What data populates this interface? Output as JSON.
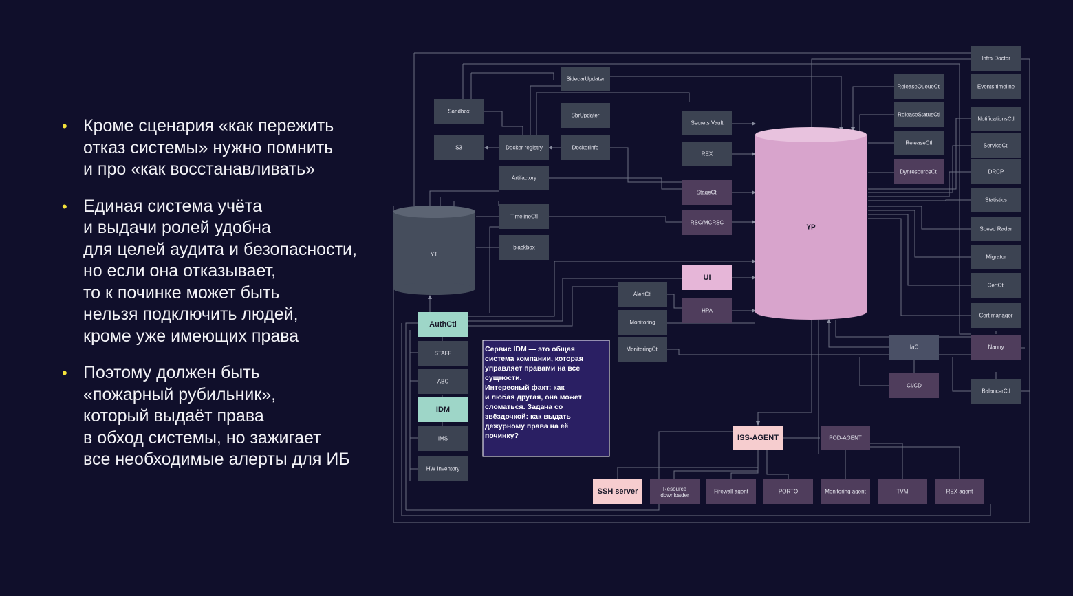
{
  "bullets": [
    "Кроме сценария «как пережить\nотказ системы» нужно помнить\nи про «как восстанавливать»",
    "Единая система учёта\nи выдачи ролей удобна\nдля целей аудита и безопасности,\nно если она отказывает,\nто к починке может быть\nнельзя подключить людей,\nкроме уже имеющих права",
    "Поэтому должен быть\n«пожарный рубильник»,\nкоторый выдаёт права\nв обход системы, но зажигает\nвсе необходимые алерты для ИБ"
  ],
  "colors": {
    "background": "#100f2b",
    "bullet_marker": "#f5e33a",
    "node_default": "#3c4352",
    "node_purple": "#4f3d5c",
    "node_teal": "#9ed6c8",
    "node_pink": "#f6cdcf",
    "yp_cylinder": "#d8a4cc",
    "note_bg": "#2a1f63"
  },
  "diagram": {
    "cylinders": {
      "yt": "YT",
      "yp": "YP"
    },
    "nodes": {
      "sidecar_updater": "SidecarUpdater",
      "sandbox": "Sandbox",
      "sbr_updater": "SbrUpdater",
      "s3": "S3",
      "docker_registry": "Docker registry",
      "docker_info": "DockerInfo",
      "artifactory": "Artifactory",
      "timeline_ctl": "TimelineCtl",
      "blackbox": "blackbox",
      "secrets_vault": "Secrets Vault",
      "rex": "REX",
      "stage_ctl": "StageCtl",
      "rsc_mcrsc": "RSC/MCRSC",
      "ui": "UI",
      "hpa": "HPA",
      "alert_ctl": "AlertCtl",
      "monitoring": "Monitoring",
      "monitoring_ctl": "MonitoringCtl",
      "auth_ctl": "AuthCtl",
      "staff": "STAFF",
      "abc": "ABC",
      "idm": "IDM",
      "ims": "IMS",
      "hw_inventory": "HW Inventory",
      "release_queue_ctl": "ReleaseQueueCtl",
      "release_status_ctl": "ReleaseStatusCtl",
      "release_ctl": "ReleaseCtl",
      "dynresource_ctl": "DynresourceCtl",
      "infra_doctor": "Infra Doctor",
      "events_timeline": "Events timeline",
      "notifications_ctl": "NotificationsCtl",
      "service_ctl": "ServiceCtl",
      "drcp": "DRCP",
      "statistics": "Statistics",
      "speed_radar": "Speed Radar",
      "migrator": "Migrator",
      "cert_ctl": "CertCtl",
      "cert_manager": "Cert manager",
      "nanny": "Nanny",
      "iac": "IaC",
      "cicd": "CI/CD",
      "balancer_ctl": "BalancerCtl",
      "iss_agent": "ISS-AGENT",
      "pod_agent": "POD-AGENT",
      "ssh_server": "SSH server",
      "resource_downloader": "Resource\ndownloader",
      "firewall_agent": "Firewall agent",
      "porto": "PORTO",
      "monitoring_agent": "Monitoring agent",
      "tvm": "TVM",
      "rex_agent": "REX agent"
    },
    "note": "Сервис IDM — это общая\nсистема компании, которая\nуправляет правами на все\nсущности.\n\nИнтересный факт: как\nи любая другая, она может\nсломаться. Задача со\nзвёздочкой: как выдать\nдежурному права на её\nпочинку?"
  }
}
